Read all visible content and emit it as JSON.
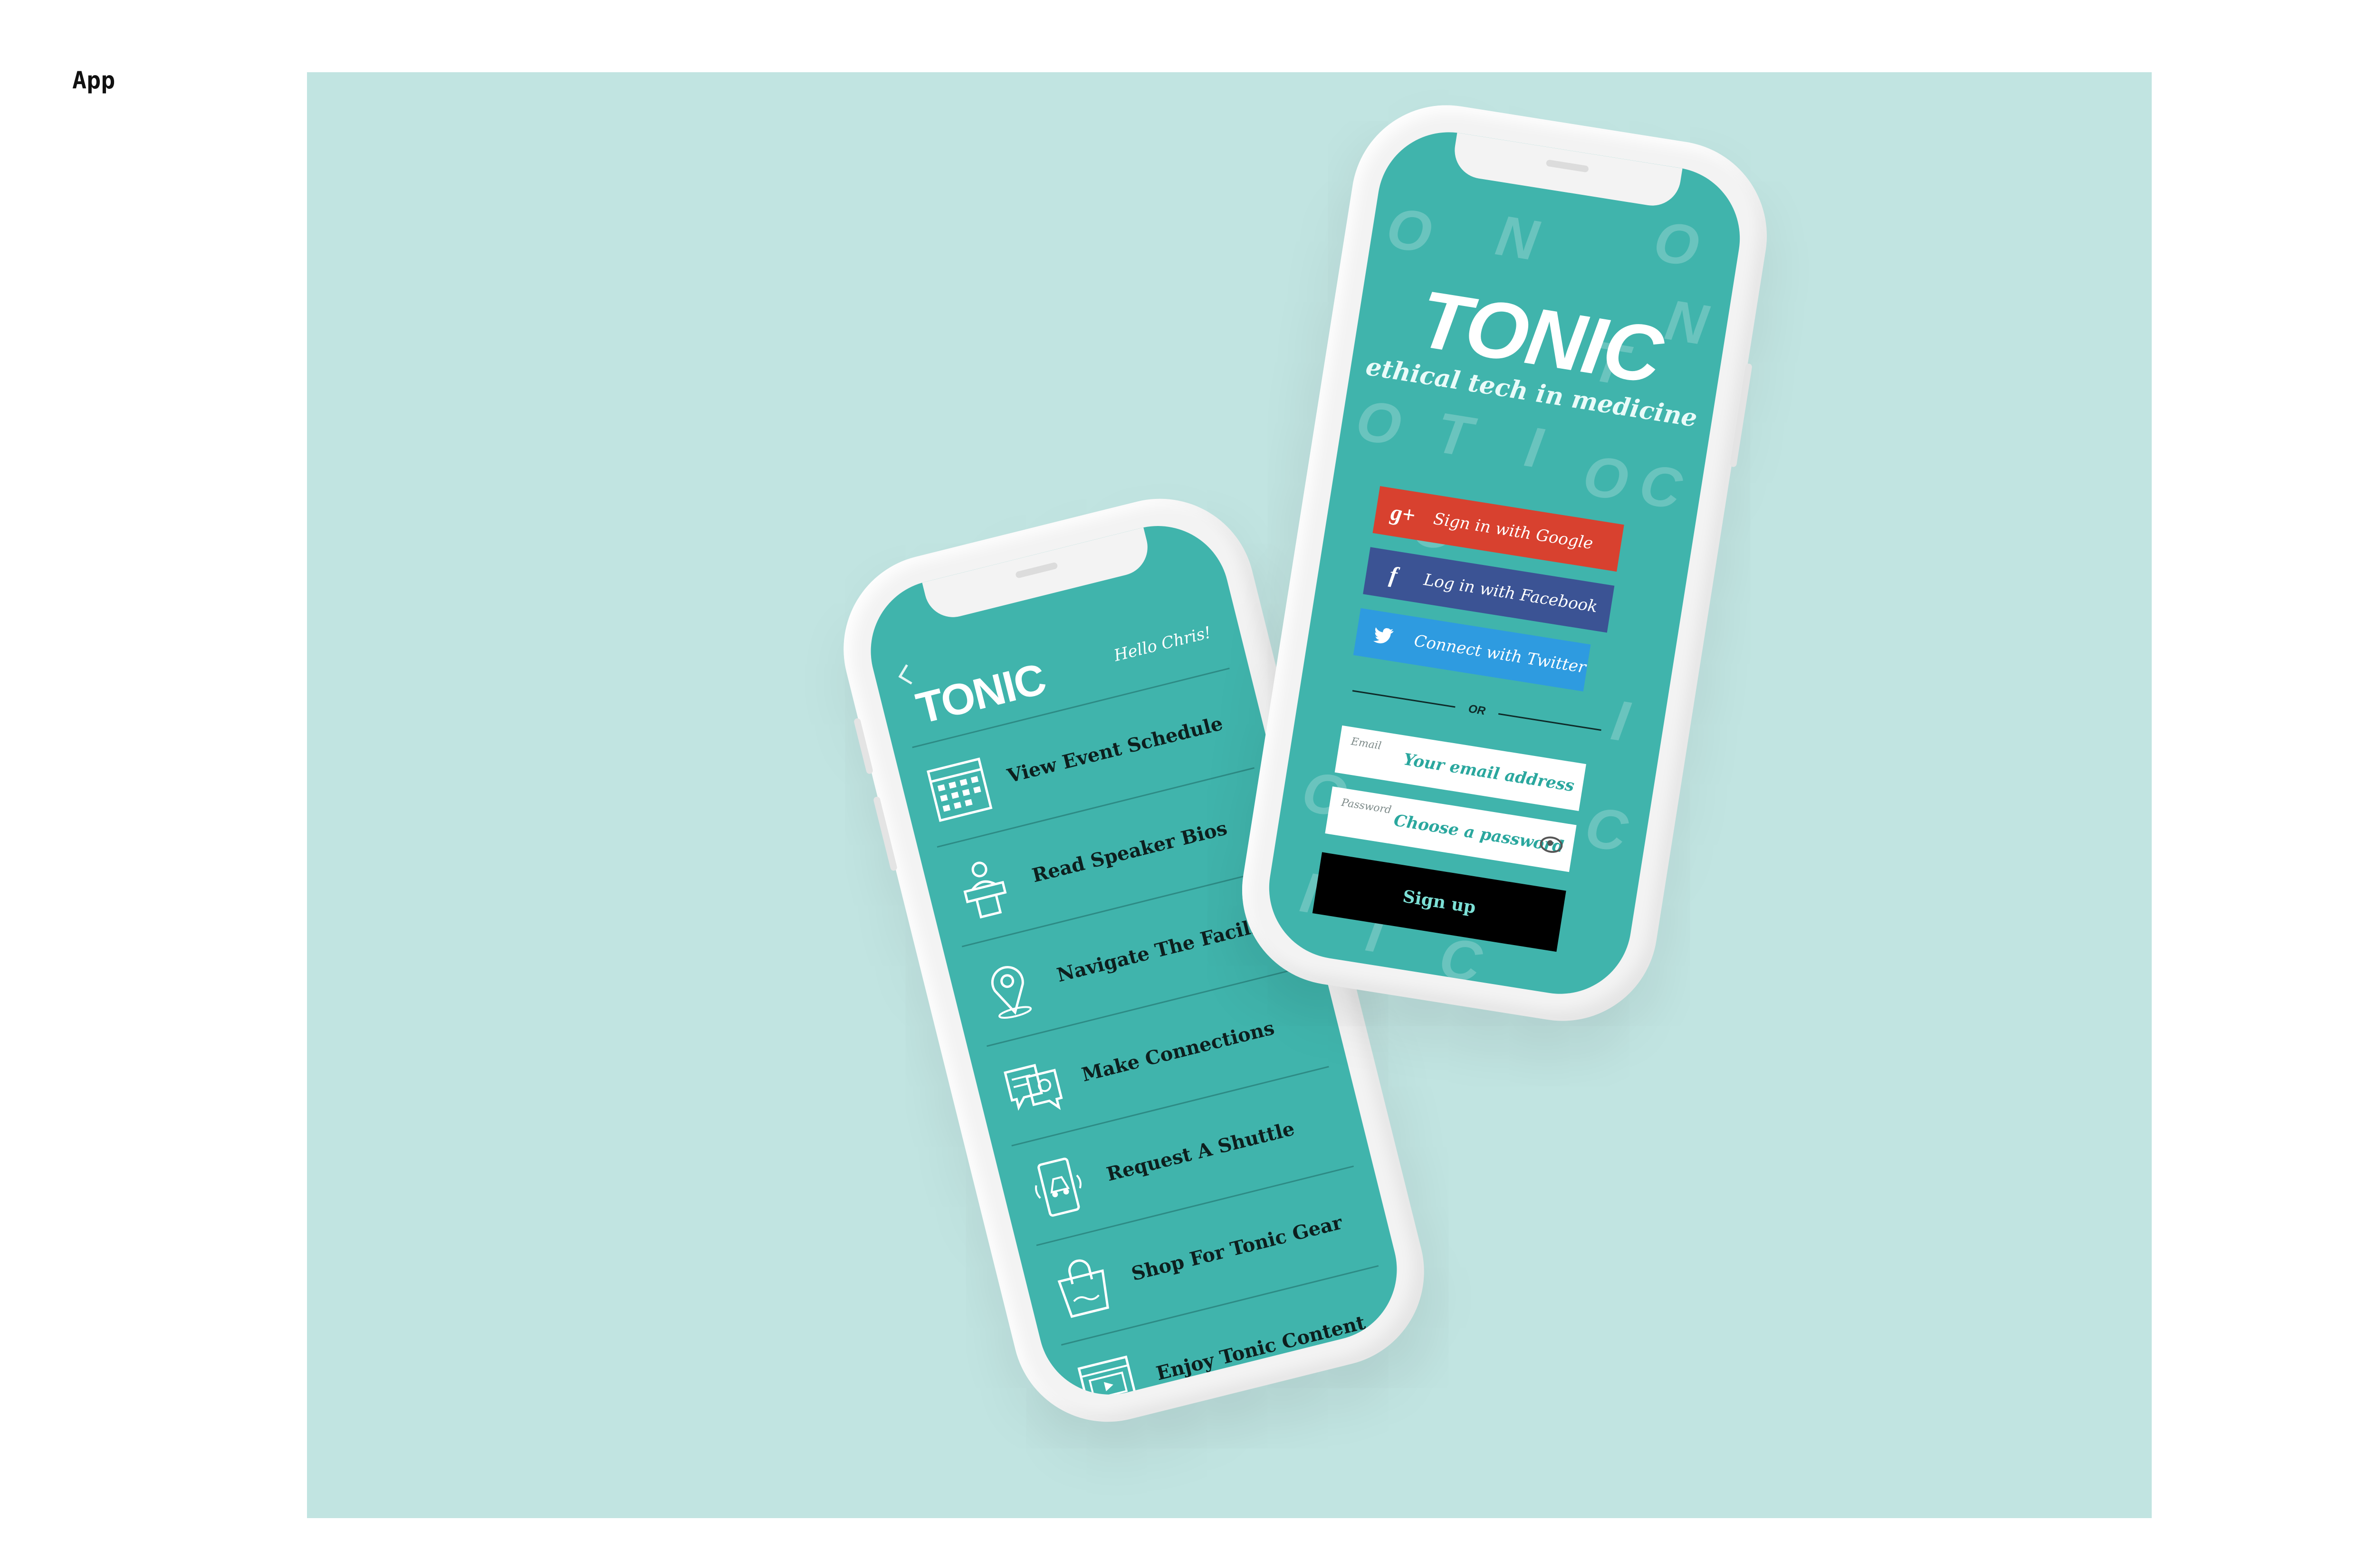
{
  "page": {
    "label": "App"
  },
  "colors": {
    "stage_bg": "#c1e4e1",
    "screen_teal": "#40b4ac",
    "google": "#d8412f",
    "facebook": "#3b5394",
    "twitter": "#2e9be0"
  },
  "menu_screen": {
    "brand": "TONIC",
    "greeting": "Hello Chris!",
    "items": [
      {
        "label": "View Event Schedule",
        "icon": "calendar-icon"
      },
      {
        "label": "Read Speaker Bios",
        "icon": "speaker-podium-icon"
      },
      {
        "label": "Navigate The Facility",
        "icon": "map-pin-icon"
      },
      {
        "label": "Make Connections",
        "icon": "chat-profile-icon"
      },
      {
        "label": "Request A Shuttle",
        "icon": "shuttle-phone-icon"
      },
      {
        "label": "Shop For Tonic Gear",
        "icon": "shopping-bag-icon"
      },
      {
        "label": "Enjoy Tonic Content",
        "icon": "video-content-icon"
      }
    ]
  },
  "login_screen": {
    "brand": "TONIC",
    "tagline": "ethical tech in medicine",
    "google_label": "Sign in with Google",
    "facebook_label": "Log in with Facebook",
    "twitter_label": "Connect with Twitter",
    "or_label": "OR",
    "email_label": "Email",
    "email_placeholder": "Your email address",
    "password_label": "Password",
    "password_placeholder": "Choose a password",
    "signup_label": "Sign up"
  }
}
